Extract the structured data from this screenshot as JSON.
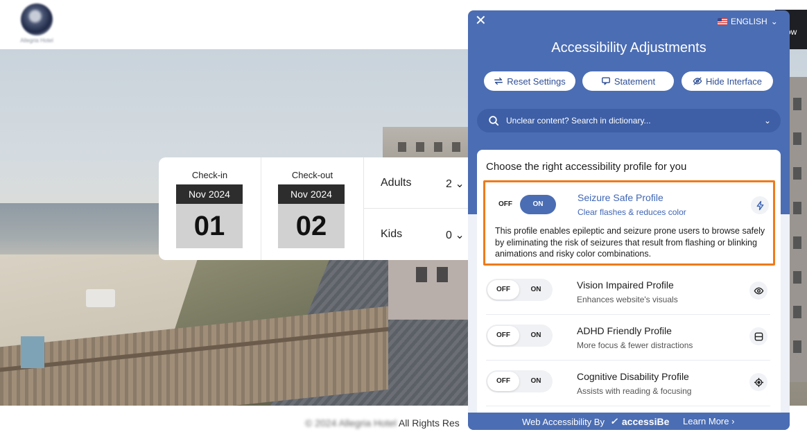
{
  "header": {
    "show_label": "ow"
  },
  "booking": {
    "checkin": {
      "label": "Check-in",
      "month": "Nov 2024",
      "day": "01"
    },
    "checkout": {
      "label": "Check-out",
      "month": "Nov 2024",
      "day": "02"
    },
    "adults": {
      "label": "Adults",
      "value": "2"
    },
    "kids": {
      "label": "Kids",
      "value": "0"
    },
    "chevron": "⌄"
  },
  "footer": {
    "copyright_blurred": "© 2024 Allegria Hotel",
    "copyright_visible": "All Rights Res"
  },
  "panel": {
    "close": "✕",
    "language": "ENGLISH",
    "title": "Accessibility Adjustments",
    "buttons": {
      "reset": "Reset Settings",
      "statement": "Statement",
      "hide": "Hide Interface"
    },
    "search_placeholder": "Unclear content? Search in dictionary...",
    "profiles_heading": "Choose the right accessibility profile for you",
    "toggle": {
      "off": "OFF",
      "on": "ON"
    },
    "profiles": [
      {
        "name": "Seizure Safe Profile",
        "subtitle": "Clear flashes & reduces color",
        "icon": "bolt-icon",
        "active": true,
        "description": "This profile enables epileptic and seizure prone users to browse safely by eliminating the risk of seizures that result from flashing or blinking animations and risky color combinations."
      },
      {
        "name": "Vision Impaired Profile",
        "subtitle": "Enhances website's visuals",
        "icon": "eye-icon",
        "active": false
      },
      {
        "name": "ADHD Friendly Profile",
        "subtitle": "More focus & fewer distractions",
        "icon": "focus-window-icon",
        "active": false
      },
      {
        "name": "Cognitive Disability Profile",
        "subtitle": "Assists with reading & focusing",
        "icon": "target-icon",
        "active": false
      }
    ],
    "footer": {
      "powered_by": "Web Accessibility By",
      "brand": "accessiBe",
      "learn_more": "Learn More ›"
    }
  },
  "colors": {
    "panel_blue": "#4b6db3",
    "highlight_orange": "#ef7a1a",
    "active_text": "#3f66b6"
  }
}
